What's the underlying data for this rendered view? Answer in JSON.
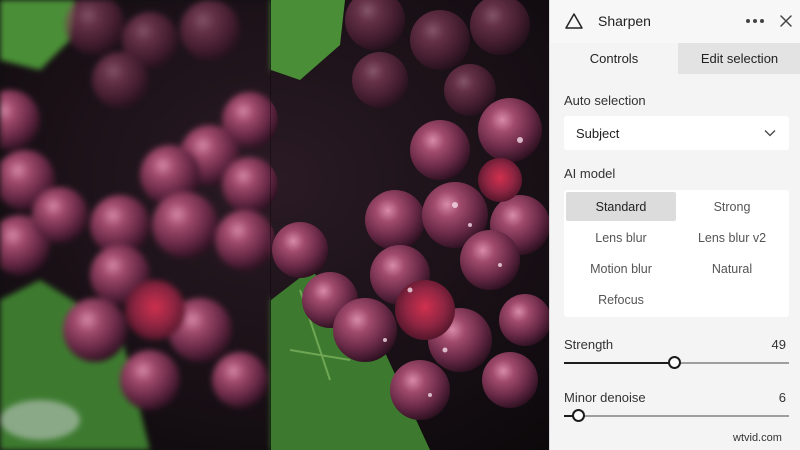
{
  "panel": {
    "title": "Sharpen",
    "more_icon": "more-horizontal-icon",
    "close_icon": "close-icon",
    "logo_icon": "triangle-logo-icon"
  },
  "tabs": [
    {
      "label": "Controls",
      "active": true
    },
    {
      "label": "Edit selection",
      "active": false
    }
  ],
  "auto_selection": {
    "label": "Auto selection",
    "value": "Subject",
    "chevron_icon": "chevron-down-icon"
  },
  "ai_model": {
    "label": "AI model",
    "options": [
      {
        "label": "Standard",
        "selected": true
      },
      {
        "label": "Strong",
        "selected": false
      },
      {
        "label": "Lens blur",
        "selected": false
      },
      {
        "label": "Lens blur v2",
        "selected": false
      },
      {
        "label": "Motion blur",
        "selected": false
      },
      {
        "label": "Natural",
        "selected": false
      },
      {
        "label": "Refocus",
        "selected": false
      }
    ]
  },
  "sliders": {
    "strength": {
      "label": "Strength",
      "value": "49",
      "fraction": 0.49
    },
    "denoise": {
      "label": "Minor denoise",
      "value": "6",
      "fraction": 0.06
    }
  },
  "watermark": "wtvid.com",
  "colors": {
    "accent": "#1c1c1c",
    "panel_bg": "#f4f4f4",
    "selected_option": "#dcdcdc",
    "grape": "#7d3550",
    "leaf": "#3f7e32"
  }
}
